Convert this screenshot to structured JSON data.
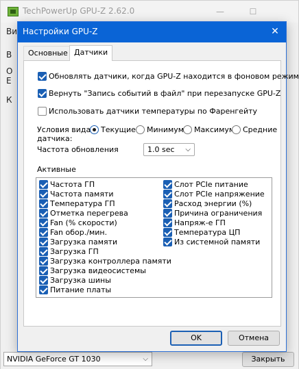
{
  "main_window": {
    "title": "TechPowerUp GPU-Z 2.62.0",
    "minimize_glyph": "—",
    "maximize_glyph": "☐",
    "peek_texts": [
      "Ви",
      "В",
      "О",
      "Е",
      "К"
    ],
    "gpu_select": "NVIDIA GeForce GT 1030",
    "close_button": "Закрыть"
  },
  "dialog": {
    "title": "Настройки GPU-Z",
    "close_glyph": "✕",
    "tabs": [
      "Основные",
      "Датчики"
    ],
    "active_tab": 1,
    "options": [
      {
        "label": "Обновлять датчики, когда GPU-Z находится в фоновом режиме",
        "checked": true
      },
      {
        "label": "Вернуть \"Запись событий в файл\" при перезапуске GPU-Z",
        "checked": true
      },
      {
        "label": "Использовать датчики температуры по Фаренгейту",
        "checked": false
      }
    ],
    "view_condition_label_line1": "Условия вида",
    "view_condition_label_line2": "датчика:",
    "radios": [
      {
        "label": "Текущие",
        "selected": true
      },
      {
        "label": "Минимум",
        "selected": false
      },
      {
        "label": "Максимум",
        "selected": false
      },
      {
        "label": "Средние",
        "selected": false
      }
    ],
    "refresh_label": "Частота обновления",
    "refresh_value": "1.0 sec",
    "active_label": "Активные",
    "sensors_left": [
      {
        "label": "Частота ГП",
        "checked": true
      },
      {
        "label": "Частота памяти",
        "checked": true
      },
      {
        "label": "Температура ГП",
        "checked": true
      },
      {
        "label": "Отметка перегрева",
        "checked": true
      },
      {
        "label": "Fan (% скорости)",
        "checked": true
      },
      {
        "label": "Fan обор./мин.",
        "checked": true
      },
      {
        "label": "Загрузка памяти",
        "checked": true
      },
      {
        "label": "Загрузка ГП",
        "checked": true
      },
      {
        "label": "Загрузка контроллера памяти",
        "checked": true
      },
      {
        "label": "Загрузка видеосистемы",
        "checked": true
      },
      {
        "label": "Загрузка шины",
        "checked": true
      },
      {
        "label": "Питание платы",
        "checked": true
      }
    ],
    "sensors_right": [
      {
        "label": "Слот PCIe питание",
        "checked": true
      },
      {
        "label": "Слот PCIe напряжение",
        "checked": true
      },
      {
        "label": "Расход энергии (%)",
        "checked": true
      },
      {
        "label": "Причина ограничения",
        "checked": true
      },
      {
        "label": "Напряж-е ГП",
        "checked": true
      },
      {
        "label": "Температура ЦП",
        "checked": true
      },
      {
        "label": "Из системной памяти",
        "checked": true
      }
    ],
    "ok_button": "OK",
    "cancel_button": "Отмена"
  },
  "colors": {
    "accent": "#0a64d6",
    "checkbox": "#1a5fb4"
  },
  "icons": {
    "app": "gpu-z-icon",
    "dropdown": "chevron-down-icon"
  }
}
